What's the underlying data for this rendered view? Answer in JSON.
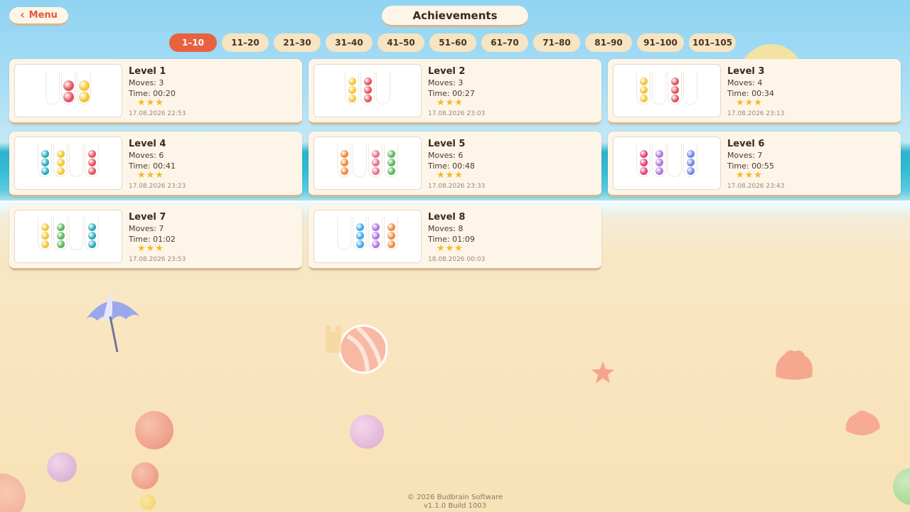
{
  "header": {
    "menu_label": "Menu",
    "title": "Achievements"
  },
  "tabs": [
    "1–10",
    "11–20",
    "21–30",
    "31–40",
    "41–50",
    "51–60",
    "61–70",
    "71–80",
    "81–90",
    "91–100",
    "101–105"
  ],
  "active_tab": "1–10",
  "colors": {
    "red": "#e3505a",
    "yellow": "#f2c531",
    "teal": "#27a9bd",
    "orange": "#ee8a39",
    "pink": "#ea6c8f",
    "green": "#58b45a",
    "magenta": "#e33d7a",
    "purple": "#b070e0",
    "blue": "#6b86e6",
    "lightblue": "#3fa6e8"
  },
  "levels": [
    {
      "title": "Level 1",
      "moves": "Moves: 3",
      "time": "Time: 00:20",
      "stars": "★★★",
      "date": "17.08.2026 22:53",
      "tubes": [
        [],
        [
          "red",
          "red"
        ],
        [
          "yellow",
          "yellow"
        ]
      ]
    },
    {
      "title": "Level 2",
      "moves": "Moves: 3",
      "time": "Time: 00:27",
      "stars": "★★★",
      "date": "17.08.2026 23:03",
      "tubes": [
        [
          "yellow",
          "yellow",
          "yellow"
        ],
        [
          "red",
          "red",
          "red"
        ],
        []
      ]
    },
    {
      "title": "Level 3",
      "moves": "Moves: 4",
      "time": "Time: 00:34",
      "stars": "★★★",
      "date": "17.08.2026 23:13",
      "tubes": [
        [
          "yellow",
          "yellow",
          "yellow"
        ],
        [],
        [
          "red",
          "red",
          "red"
        ],
        []
      ]
    },
    {
      "title": "Level 4",
      "moves": "Moves: 6",
      "time": "Time: 00:41",
      "stars": "★★★",
      "date": "17.08.2026 23:23",
      "tubes": [
        [
          "teal",
          "teal",
          "teal"
        ],
        [
          "yellow",
          "yellow",
          "yellow"
        ],
        [],
        [
          "red",
          "red",
          "red"
        ]
      ]
    },
    {
      "title": "Level 5",
      "moves": "Moves: 6",
      "time": "Time: 00:48",
      "stars": "★★★",
      "date": "17.08.2026 23:33",
      "tubes": [
        [
          "orange",
          "orange",
          "orange"
        ],
        [],
        [
          "pink",
          "pink",
          "pink"
        ],
        [
          "green",
          "green",
          "green"
        ]
      ]
    },
    {
      "title": "Level 6",
      "moves": "Moves: 7",
      "time": "Time: 00:55",
      "stars": "★★★",
      "date": "17.08.2026 23:43",
      "tubes": [
        [
          "magenta",
          "magenta",
          "magenta"
        ],
        [
          "purple",
          "purple",
          "purple"
        ],
        [],
        [
          "blue",
          "blue",
          "blue"
        ]
      ]
    },
    {
      "title": "Level 7",
      "moves": "Moves: 7",
      "time": "Time: 01:02",
      "stars": "★★★",
      "date": "17.08.2026 23:53",
      "tubes": [
        [
          "yellow",
          "yellow",
          "yellow"
        ],
        [
          "green",
          "green",
          "green"
        ],
        [],
        [
          "teal",
          "teal",
          "teal"
        ]
      ]
    },
    {
      "title": "Level 8",
      "moves": "Moves: 8",
      "time": "Time: 01:09",
      "stars": "★★★",
      "date": "18.08.2026 00:03",
      "tubes": [
        [],
        [
          "lightblue",
          "lightblue",
          "lightblue"
        ],
        [
          "purple",
          "purple",
          "purple"
        ],
        [
          "orange",
          "orange",
          "orange"
        ]
      ]
    }
  ],
  "footer": {
    "copyright": "© 2026 Budbrain Software",
    "version": "v1.1.0 Build 1003"
  }
}
